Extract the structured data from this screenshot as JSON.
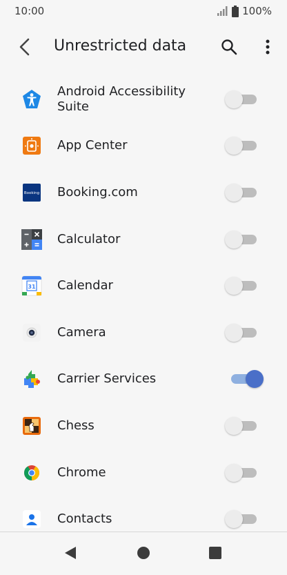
{
  "status_bar": {
    "time": "10:00",
    "battery": "100%"
  },
  "app_bar": {
    "title": "Unrestricted data",
    "back_icon": "back-arrow-icon",
    "search_icon": "search-icon",
    "more_icon": "more-vert-icon"
  },
  "apps": [
    {
      "label": "Android Accessibility Suite",
      "icon": "accessibility-icon",
      "enabled": false
    },
    {
      "label": "App Center",
      "icon": "app-center-icon",
      "enabled": false
    },
    {
      "label": "Booking.com",
      "icon": "booking-icon",
      "icon_text": "Booking",
      "enabled": false
    },
    {
      "label": "Calculator",
      "icon": "calculator-icon",
      "enabled": false
    },
    {
      "label": "Calendar",
      "icon": "calendar-icon",
      "icon_text": "31",
      "enabled": false
    },
    {
      "label": "Camera",
      "icon": "camera-icon",
      "enabled": false
    },
    {
      "label": "Carrier Services",
      "icon": "carrier-services-icon",
      "enabled": true
    },
    {
      "label": "Chess",
      "icon": "chess-icon",
      "enabled": false
    },
    {
      "label": "Chrome",
      "icon": "chrome-icon",
      "enabled": false
    },
    {
      "label": "Contacts",
      "icon": "contacts-icon",
      "enabled": false
    }
  ],
  "colors": {
    "background": "#f6f6f6",
    "toggle_on_thumb": "#4a6fc8",
    "toggle_on_track": "#8fb0e0",
    "toggle_off_thumb": "#ececec",
    "toggle_off_track": "#bdbdbd"
  },
  "nav_bar": {
    "back_icon": "nav-back-icon",
    "home_icon": "nav-home-icon",
    "recents_icon": "nav-recents-icon"
  }
}
